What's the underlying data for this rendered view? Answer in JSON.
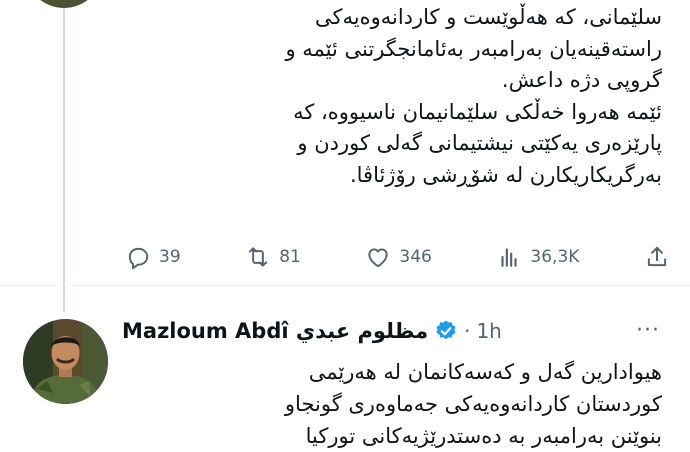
{
  "tweet1": {
    "lines": [
      "سلێمانی، کە هەڵوێست و کاردانەوەیەکی",
      "راستەقینەیان بەرامبەر بەئامانجگرتنی ئێمە و",
      "گروپی دژە داعش.",
      "ئێمە هەروا خەڵکی سلێمانیمان ناسیووە، کە",
      "پارێزەری یەکێتی نیشتیمانی گەلی کوردن و",
      "بەرگریکاریکارن لە شۆڕشی رۆژئاڤا."
    ],
    "actions": {
      "replies": "39",
      "retweets": "81",
      "likes": "346",
      "views": "36,3K"
    }
  },
  "tweet2": {
    "name": "Mazloum Abdî مظلوم عبدي",
    "time": "1h",
    "more": "···",
    "lines": [
      "هیوادارین  گەل و کەسەکانمان لە هەرێمی",
      "کوردستان کاردانەوەیەکی جەماوەری گونجاو",
      "بنوێنن بەرامبەر بە دەستدرێژیەکانی تورکیا"
    ]
  },
  "colors": {
    "text": "#0f1419",
    "muted": "#536471",
    "verified": "#1d9bf0",
    "thread_line": "#cfd9de"
  }
}
